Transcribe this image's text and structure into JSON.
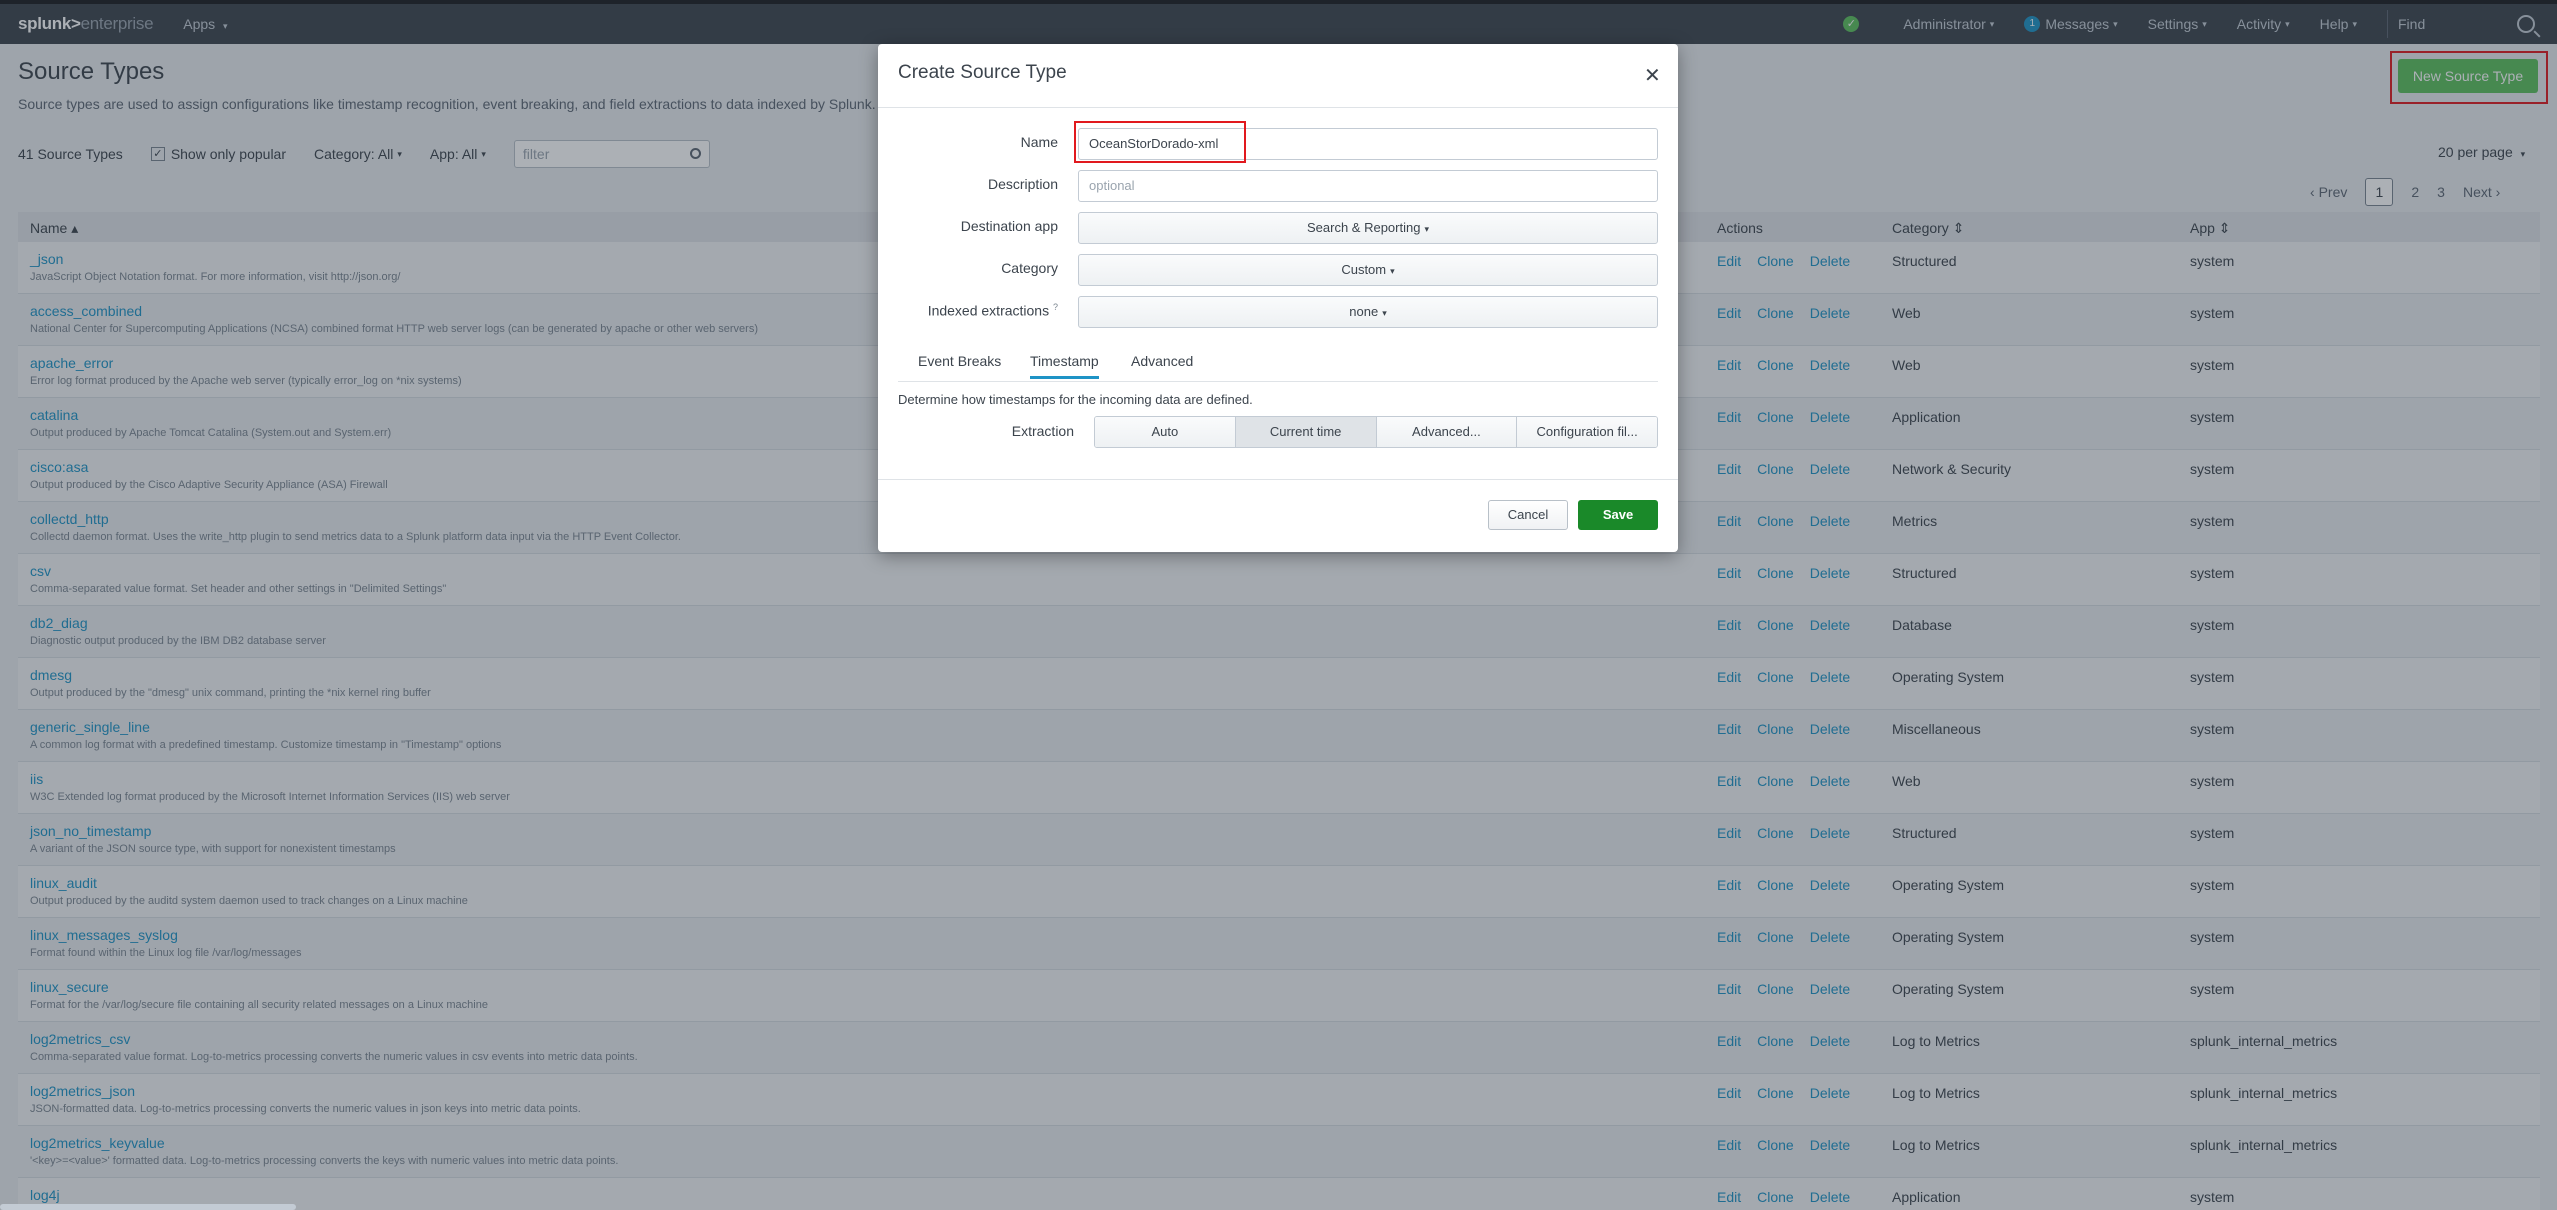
{
  "nav": {
    "brand_main": "splunk>",
    "brand_sub": "enterprise",
    "apps": "Apps",
    "user": "Administrator",
    "messages_count": "1",
    "messages": "Messages",
    "settings": "Settings",
    "activity": "Activity",
    "help": "Help",
    "find": "Find"
  },
  "page": {
    "title": "Source Types",
    "description": "Source types are used to assign configurations like timestamp recognition, event breaking, and field extractions to data indexed by Splunk.",
    "new_button": "New Source Type",
    "count": "41 Source Types",
    "show_popular": "Show only popular",
    "category_filter": "Category: All",
    "app_filter": "App: All",
    "filter_placeholder": "filter",
    "per_page": "20 per page",
    "pager": {
      "prev": "Prev",
      "p1": "1",
      "p2": "2",
      "p3": "3",
      "next": "Next"
    }
  },
  "table": {
    "headers": {
      "name": "Name",
      "actions": "Actions",
      "category": "Category",
      "app": "App"
    },
    "actions": {
      "edit": "Edit",
      "clone": "Clone",
      "delete": "Delete"
    },
    "rows": [
      {
        "name": "_json",
        "desc": "JavaScript Object Notation format. For more information, visit http://json.org/",
        "cat": "Structured",
        "app": "system"
      },
      {
        "name": "access_combined",
        "desc": "National Center for Supercomputing Applications (NCSA) combined format HTTP web server logs (can be generated by apache or other web servers)",
        "cat": "Web",
        "app": "system"
      },
      {
        "name": "apache_error",
        "desc": "Error log format produced by the Apache web server (typically error_log on *nix systems)",
        "cat": "Web",
        "app": "system"
      },
      {
        "name": "catalina",
        "desc": "Output produced by Apache Tomcat Catalina (System.out and System.err)",
        "cat": "Application",
        "app": "system"
      },
      {
        "name": "cisco:asa",
        "desc": "Output produced by the Cisco Adaptive Security Appliance (ASA) Firewall",
        "cat": "Network & Security",
        "app": "system"
      },
      {
        "name": "collectd_http",
        "desc": "Collectd daemon format. Uses the write_http plugin to send metrics data to a Splunk platform data input via the HTTP Event Collector.",
        "cat": "Metrics",
        "app": "system"
      },
      {
        "name": "csv",
        "desc": "Comma-separated value format. Set header and other settings in \"Delimited Settings\"",
        "cat": "Structured",
        "app": "system"
      },
      {
        "name": "db2_diag",
        "desc": "Diagnostic output produced by the IBM DB2 database server",
        "cat": "Database",
        "app": "system"
      },
      {
        "name": "dmesg",
        "desc": "Output produced by the \"dmesg\" unix command, printing the *nix kernel ring buffer",
        "cat": "Operating System",
        "app": "system"
      },
      {
        "name": "generic_single_line",
        "desc": "A common log format with a predefined timestamp. Customize timestamp in \"Timestamp\" options",
        "cat": "Miscellaneous",
        "app": "system"
      },
      {
        "name": "iis",
        "desc": "W3C Extended log format produced by the Microsoft Internet Information Services (IIS) web server",
        "cat": "Web",
        "app": "system"
      },
      {
        "name": "json_no_timestamp",
        "desc": "A variant of the JSON source type, with support for nonexistent timestamps",
        "cat": "Structured",
        "app": "system"
      },
      {
        "name": "linux_audit",
        "desc": "Output produced by the auditd system daemon used to track changes on a Linux machine",
        "cat": "Operating System",
        "app": "system"
      },
      {
        "name": "linux_messages_syslog",
        "desc": "Format found within the Linux log file /var/log/messages",
        "cat": "Operating System",
        "app": "system"
      },
      {
        "name": "linux_secure",
        "desc": "Format for the /var/log/secure file containing all security related messages on a Linux machine",
        "cat": "Operating System",
        "app": "system"
      },
      {
        "name": "log2metrics_csv",
        "desc": "Comma-separated value format. Log-to-metrics processing converts the numeric values in csv events into metric data points.",
        "cat": "Log to Metrics",
        "app": "splunk_internal_metrics"
      },
      {
        "name": "log2metrics_json",
        "desc": "JSON-formatted data. Log-to-metrics processing converts the numeric values in json keys into metric data points.",
        "cat": "Log to Metrics",
        "app": "splunk_internal_metrics"
      },
      {
        "name": "log2metrics_keyvalue",
        "desc": "'<key>=<value>' formatted data. Log-to-metrics processing converts the keys with numeric values into metric data points.",
        "cat": "Log to Metrics",
        "app": "splunk_internal_metrics"
      },
      {
        "name": "log4j",
        "desc": "",
        "cat": "Application",
        "app": "system"
      }
    ]
  },
  "modal": {
    "title": "Create Source Type",
    "name_label": "Name",
    "name_value": "OceanStorDorado-xml",
    "desc_label": "Description",
    "desc_placeholder": "optional",
    "dest_label": "Destination app",
    "dest_value": "Search & Reporting",
    "category_label": "Category",
    "category_value": "Custom",
    "indexed_label": "Indexed extractions",
    "indexed_value": "none",
    "tabs": {
      "event_breaks": "Event Breaks",
      "timestamp": "Timestamp",
      "advanced": "Advanced"
    },
    "help_text": "Determine how timestamps for the incoming data are defined.",
    "extraction_label": "Extraction",
    "extraction_options": {
      "auto": "Auto",
      "current": "Current time",
      "advanced": "Advanced...",
      "config": "Configuration fil..."
    },
    "cancel": "Cancel",
    "save": "Save"
  },
  "colors": {
    "accent": "#1e93c6",
    "save_green": "#1a8929",
    "highlight_red": "#e1191e"
  }
}
